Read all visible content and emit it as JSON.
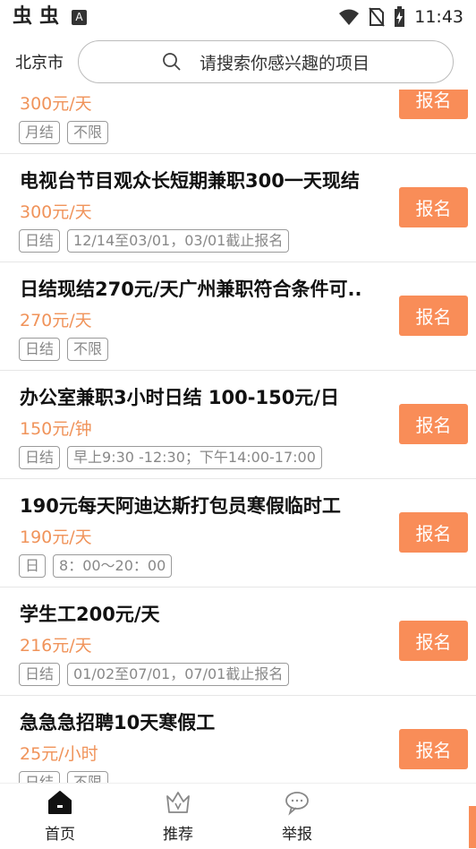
{
  "status_bar": {
    "icons": [
      "bug-icon",
      "bug-icon",
      "a-icon",
      "wifi-icon",
      "no-sim-icon",
      "battery-charging-icon"
    ],
    "a_letter": "A",
    "time": "11:43"
  },
  "header": {
    "city": "北京市",
    "search_placeholder": "请搜索你感兴趣的项目"
  },
  "colors": {
    "accent": "#f98d58",
    "salary": "#f0935a"
  },
  "jobs": [
    {
      "title": "",
      "salary": "300元/天",
      "tags": [
        "月结",
        "不限"
      ],
      "signup_label": "报名"
    },
    {
      "title": "电视台节目观众长短期兼职300一天现结",
      "salary": "300元/天",
      "tags": [
        "日结",
        "12/14至03/01，03/01截止报名"
      ],
      "signup_label": "报名"
    },
    {
      "title": "日结现结270元/天广州兼职符合条件可..",
      "salary": "270元/天",
      "tags": [
        "日结",
        "不限"
      ],
      "signup_label": "报名"
    },
    {
      "title": "办公室兼职3小时日结 100-150元/日",
      "salary": "150元/钟",
      "tags": [
        "日结",
        "早上9:30 -12:30；下午14:00-17:00"
      ],
      "signup_label": "报名"
    },
    {
      "title": " 190元每天阿迪达斯打包员寒假临时工",
      "salary": "190元/天",
      "tags": [
        "日",
        "8：00～20：00"
      ],
      "signup_label": "报名"
    },
    {
      "title": "学生工200元/天",
      "salary": "216元/天",
      "tags": [
        "日结",
        "01/02至07/01，07/01截止报名"
      ],
      "signup_label": "报名"
    },
    {
      "title": "急急急招聘10天寒假工",
      "salary": "25元/小时",
      "tags": [
        "日结",
        "不限"
      ],
      "signup_label": "报名"
    }
  ],
  "tabbar": {
    "tabs": [
      {
        "label": "首页",
        "icon": "home-icon",
        "active": true
      },
      {
        "label": "推荐",
        "icon": "crown-icon",
        "active": false
      },
      {
        "label": "举报",
        "icon": "chat-bubble-icon",
        "active": false
      }
    ]
  }
}
